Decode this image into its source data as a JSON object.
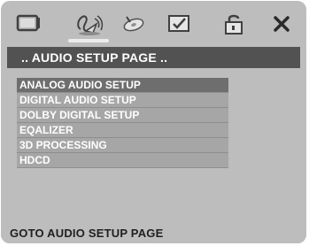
{
  "toolbar": {
    "icons": [
      {
        "name": "tv-screen-icon"
      },
      {
        "name": "audio-speaker-icon",
        "active": true
      },
      {
        "name": "dolby-disc-icon"
      },
      {
        "name": "preferences-checkmark-icon"
      },
      {
        "name": "password-lock-icon"
      },
      {
        "name": "exit-close-icon"
      }
    ]
  },
  "header": {
    "title": ".. AUDIO SETUP PAGE .."
  },
  "menu": {
    "items": [
      {
        "label": "ANALOG AUDIO SETUP",
        "selected": true
      },
      {
        "label": "DIGITAL AUDIO SETUP"
      },
      {
        "label": "DOLBY DIGITAL SETUP"
      },
      {
        "label": "EQALIZER"
      },
      {
        "label": "3D PROCESSING"
      },
      {
        "label": "HDCD"
      }
    ]
  },
  "footer": {
    "status": "GOTO AUDIO SETUP PAGE"
  },
  "colors": {
    "background": "#bdbdbd",
    "header_bar": "#525252",
    "menu_item": "#a6a6a6",
    "menu_item_selected": "#6e6e6e",
    "active_marker": "#ececec"
  }
}
